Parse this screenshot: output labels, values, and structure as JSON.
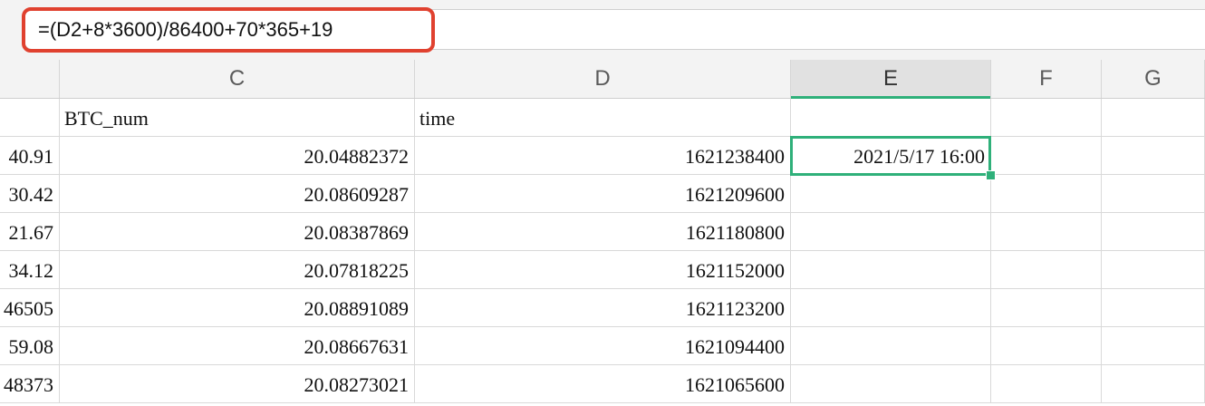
{
  "formula_bar": {
    "formula": "=(D2+8*3600)/86400+70*365+19"
  },
  "columns": {
    "c": "C",
    "d": "D",
    "e": "E",
    "f": "F",
    "g": "G"
  },
  "accent": {
    "selection": "#2fb07a",
    "highlight": "#e0412f"
  },
  "rows": [
    {
      "b": "",
      "c": "BTC_num",
      "d": "time",
      "e": ""
    },
    {
      "b": "40.91",
      "c": "20.04882372",
      "d": "1621238400",
      "e": "2021/5/17 16:00"
    },
    {
      "b": "30.42",
      "c": "20.08609287",
      "d": "1621209600",
      "e": ""
    },
    {
      "b": "21.67",
      "c": "20.08387869",
      "d": "1621180800",
      "e": ""
    },
    {
      "b": "34.12",
      "c": "20.07818225",
      "d": "1621152000",
      "e": ""
    },
    {
      "b": "46505",
      "c": "20.08891089",
      "d": "1621123200",
      "e": ""
    },
    {
      "b": "59.08",
      "c": "20.08667631",
      "d": "1621094400",
      "e": ""
    },
    {
      "b": "48373",
      "c": "20.08273021",
      "d": "1621065600",
      "e": ""
    }
  ]
}
